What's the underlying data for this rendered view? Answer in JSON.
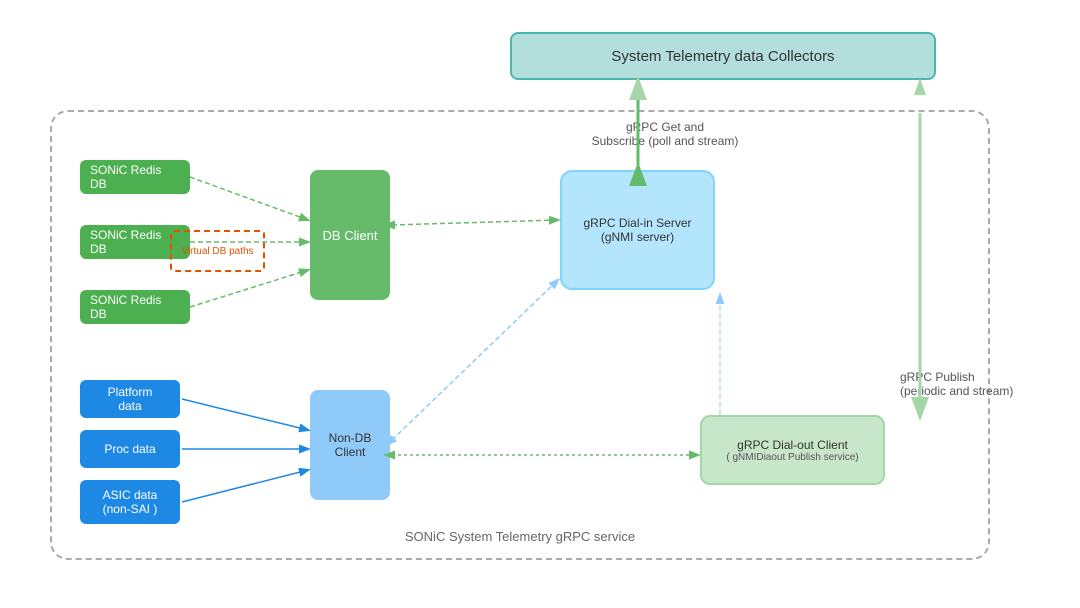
{
  "diagram": {
    "title": "System Telemetry data Collectors",
    "main_label": "SONiC System Telemetry gRPC service",
    "collectors": {
      "label": "System Telemetry data Collectors"
    },
    "redis_dbs": [
      {
        "label": "SONiC Redis DB"
      },
      {
        "label": "SONiC Redis DB"
      },
      {
        "label": "SONiC Redis DB"
      }
    ],
    "virtual_db": {
      "label": "Virtual DB paths"
    },
    "db_client": {
      "label": "DB Client"
    },
    "grpc_dialin": {
      "label": "gRPC Dial-in Server\n(gNMI server)"
    },
    "data_sources": [
      {
        "label": "Platform\ndata"
      },
      {
        "label": "Proc data"
      },
      {
        "label": "ASIC data\n(non-SAI)"
      }
    ],
    "nondb_client": {
      "label": "Non-DB\nClient"
    },
    "grpc_dialout": {
      "label": "gRPC Dial-out Client",
      "sublabel": "( gNMIDiaout Publish service)"
    },
    "arrow_labels": {
      "grpc_get": "gRPC Get  and\nSubscribe (poll and stream)",
      "grpc_publish": "gRPC Publish\n(periodic and stream)"
    }
  }
}
